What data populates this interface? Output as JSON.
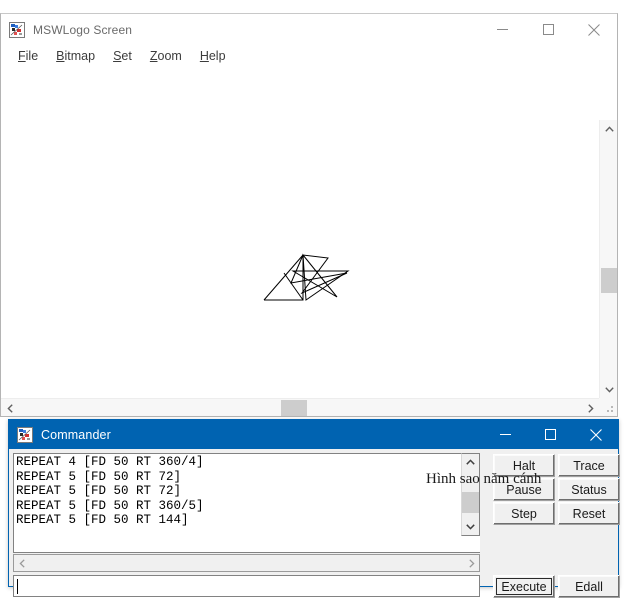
{
  "main_window": {
    "title": "MSWLogo Screen",
    "icon": "mswlogo-icon",
    "menu": [
      {
        "label": "File",
        "accel": "F"
      },
      {
        "label": "Bitmap",
        "accel": "B"
      },
      {
        "label": "Set",
        "accel": "S"
      },
      {
        "label": "Zoom",
        "accel": "Z"
      },
      {
        "label": "Help",
        "accel": "H"
      }
    ],
    "controls": {
      "minimize": "minimize-icon",
      "maximize": "maximize-icon",
      "close": "close-icon"
    },
    "canvas_caption": "Hình sao năm cánh",
    "scrollbars": {
      "vertical_up": "chevron-up-icon",
      "vertical_down": "chevron-down-icon",
      "horizontal_left": "chevron-left-icon",
      "horizontal_right": "chevron-right-icon",
      "resize_grip": "resize-grip-icon"
    }
  },
  "commander_window": {
    "title": "Commander",
    "icon": "mswlogo-icon",
    "controls": {
      "minimize": "minimize-icon",
      "maximize": "maximize-icon",
      "close": "close-icon"
    },
    "history_lines": [
      "REPEAT 4 [FD 50 RT 360/4]",
      "REPEAT 5 [FD 50 RT 72]",
      "REPEAT 5 [FD 50 RT 72]",
      "REPEAT 5 [FD 50 RT 360/5]",
      "REPEAT 5 [FD 50 RT 144]"
    ],
    "history_text": "REPEAT 4 [FD 50 RT 360/4]\nREPEAT 5 [FD 50 RT 72]\nREPEAT 5 [FD 50 RT 72]\nREPEAT 5 [FD 50 RT 360/5]\nREPEAT 5 [FD 50 RT 144]",
    "input_value": "",
    "input_placeholder": "",
    "buttons": {
      "halt": "Halt",
      "trace": "Trace",
      "pause": "Pause",
      "status": "Status",
      "step": "Step",
      "reset": "Reset",
      "execute": "Execute",
      "edall": "Edall"
    }
  },
  "colors": {
    "title_active": "#0063b1",
    "window_face": "#f0f0f0",
    "canvas": "#ffffff",
    "ink": "#000000",
    "scroll_thumb": "#cdcdcd"
  }
}
